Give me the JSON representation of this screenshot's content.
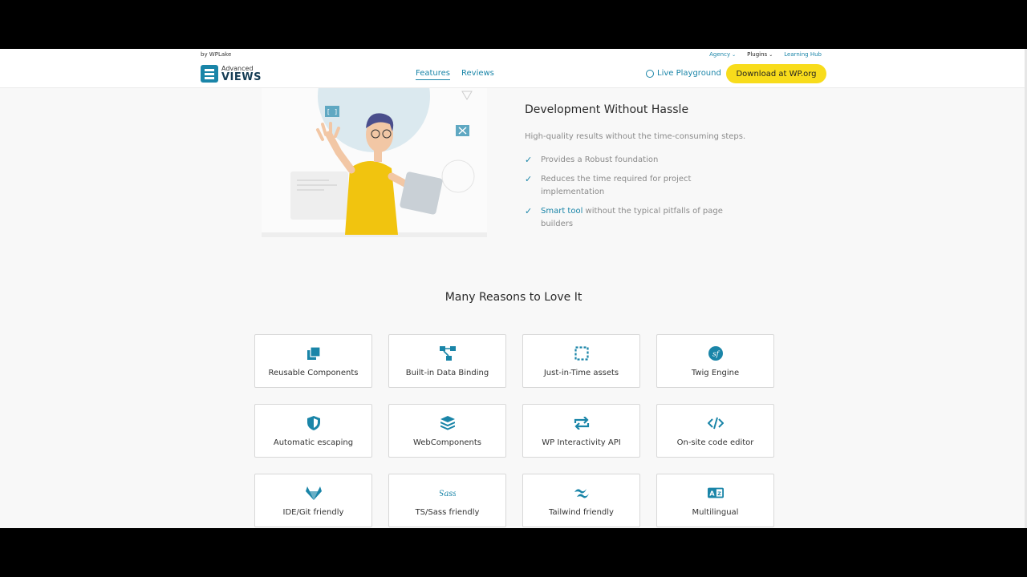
{
  "topbar": {
    "by": "by WPLake",
    "links": [
      {
        "label": "Agency",
        "caret": true
      },
      {
        "label": "Plugins",
        "caret": true
      },
      {
        "label": "Learning Hub",
        "caret": false
      }
    ]
  },
  "header": {
    "logo_line1": "Advanced",
    "logo_line2": "VIEWS",
    "nav": [
      {
        "label": "Features",
        "active": true
      },
      {
        "label": "Reviews",
        "active": false
      }
    ],
    "playground": "Live Playground",
    "download": "Download at WP.org"
  },
  "hero": {
    "title": "Development Without Hassle",
    "subtitle": "High-quality results without the time-consuming steps.",
    "items": [
      {
        "highlight": "",
        "text": "Provides a Robust foundation"
      },
      {
        "highlight": "",
        "text": "Reduces the time required for project implementation"
      },
      {
        "highlight": "Smart tool",
        "text": " without the typical pitfalls of page builders"
      }
    ]
  },
  "reasons": {
    "title": "Many Reasons to Love It",
    "cards": [
      {
        "label": "Reusable Components",
        "icon": "copy-icon"
      },
      {
        "label": "Built-in Data Binding",
        "icon": "sitemap-icon"
      },
      {
        "label": "Just-in-Time assets",
        "icon": "dashed-square-icon"
      },
      {
        "label": "Twig Engine",
        "icon": "symfony-icon"
      },
      {
        "label": "Automatic escaping",
        "icon": "shield-icon"
      },
      {
        "label": "WebComponents",
        "icon": "layers-icon"
      },
      {
        "label": "WP Interactivity API",
        "icon": "repeat-icon"
      },
      {
        "label": "On-site code editor",
        "icon": "code-icon"
      },
      {
        "label": "IDE/Git friendly",
        "icon": "gitlab-icon"
      },
      {
        "label": "TS/Sass friendly",
        "icon": "sass-icon"
      },
      {
        "label": "Tailwind friendly",
        "icon": "tailwind-icon"
      },
      {
        "label": "Multilingual",
        "icon": "translate-icon"
      }
    ]
  },
  "colors": {
    "accent": "#1a85a8",
    "button": "#f8dc1b"
  }
}
